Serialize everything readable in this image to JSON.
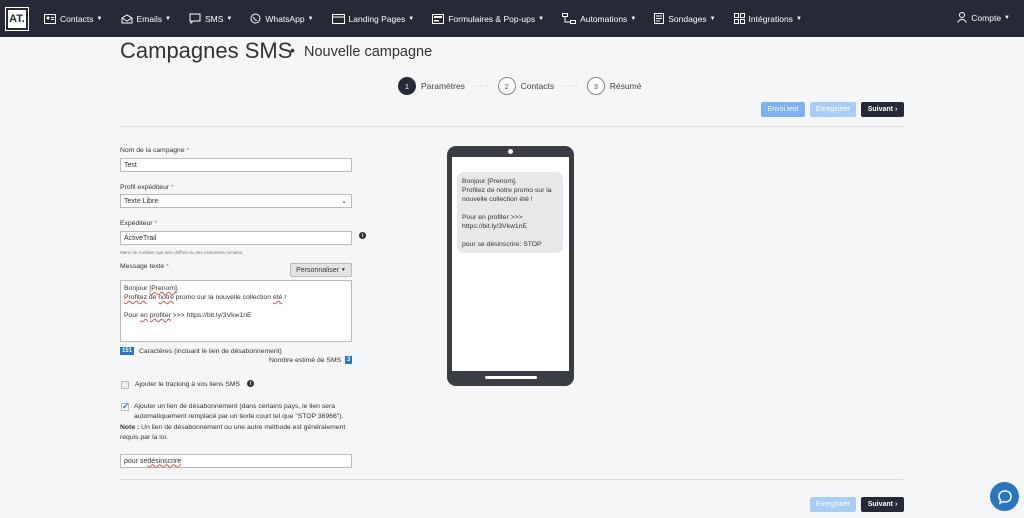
{
  "brand": {
    "logo_text": "AT."
  },
  "nav": {
    "items": [
      {
        "label": "Contacts",
        "icon": "contacts-icon"
      },
      {
        "label": "Emails",
        "icon": "envelope-icon"
      },
      {
        "label": "SMS",
        "icon": "chat-bubble-icon"
      },
      {
        "label": "WhatsApp",
        "icon": "whatsapp-icon"
      },
      {
        "label": "Landing Pages",
        "icon": "window-icon"
      },
      {
        "label": "Formulaires & Pop-ups",
        "icon": "form-icon"
      },
      {
        "label": "Automations",
        "icon": "flow-icon"
      },
      {
        "label": "Sondages",
        "icon": "survey-icon"
      },
      {
        "label": "Intégrations",
        "icon": "puzzle-icon"
      }
    ],
    "account": "Compte"
  },
  "page": {
    "title": "Campagnes SMS",
    "separator": "•",
    "subtitle": "Nouvelle campagne"
  },
  "steps": [
    {
      "num": "1",
      "label": "Paramètres",
      "active": true
    },
    {
      "num": "2",
      "label": "Contacts",
      "active": false
    },
    {
      "num": "3",
      "label": "Résumé",
      "active": false
    }
  ],
  "step_dots": "·····",
  "actions": {
    "test": "Envoi test",
    "save": "Enregistrer",
    "next": "Suivant"
  },
  "form": {
    "name_label": "Nom de la campagne",
    "name_value": "Test",
    "profile_label": "Profil expéditeur",
    "profile_value": "Texte Libre",
    "sender_label": "Expéditeur",
    "sender_value": "ActiveTrail",
    "sender_hint": "Merci de n'utiliser que des chiffres ou des caractères romains.",
    "message_label": "Message texte",
    "personalize": "Personnaliser",
    "message_lines": {
      "l1a": "Bonjour ",
      "l1b": "[Prenom]",
      "l1c": ",",
      "l2a": "Profitez",
      "l2b": " de ",
      "l2c": "notre",
      "l2d": " promo sur la nouvelle collection ",
      "l2e": "été",
      "l2f": " !",
      "l4a": "Pour ",
      "l4b": "en",
      "l4c": " ",
      "l4d": "profiter",
      "l4e": " >>> https://bit.ly/3Vkw1nE"
    },
    "char_count": "151",
    "char_label": "Caractères (incluant le lien de désabonnement)",
    "sms_est_label": "Nombre estimé de SMS",
    "sms_est_value": "3",
    "tracking_label": "Ajouter le tracking à vos liens SMS",
    "tracking_checked": false,
    "unsub_label": "Ajouter un lien de désabonnement (dans certains pays, le lien sera automatiquement remplacé par un texte court tel que \"STOP 36966\").",
    "note_bold": "Note :",
    "note_text": " Un lien de désabonnement ou une autre méthode est généralement requis par la loi.",
    "unsub_checked": true,
    "unsub_a": "pour se ",
    "unsub_b": "désinscrire"
  },
  "preview": {
    "line1": "Bonjour [Prenom],",
    "line2": "Profitez de notre promo sur la nouvelle collection été !",
    "line3": "Pour en profiter >>> https://bit.ly/3Vkw1nE",
    "line4": "pour se désinscrire: STOP"
  },
  "colors": {
    "topbar": "#262a36",
    "accent": "#2a77c0",
    "btn_light": "#7fb0f0",
    "btn_dark": "#262a36"
  }
}
